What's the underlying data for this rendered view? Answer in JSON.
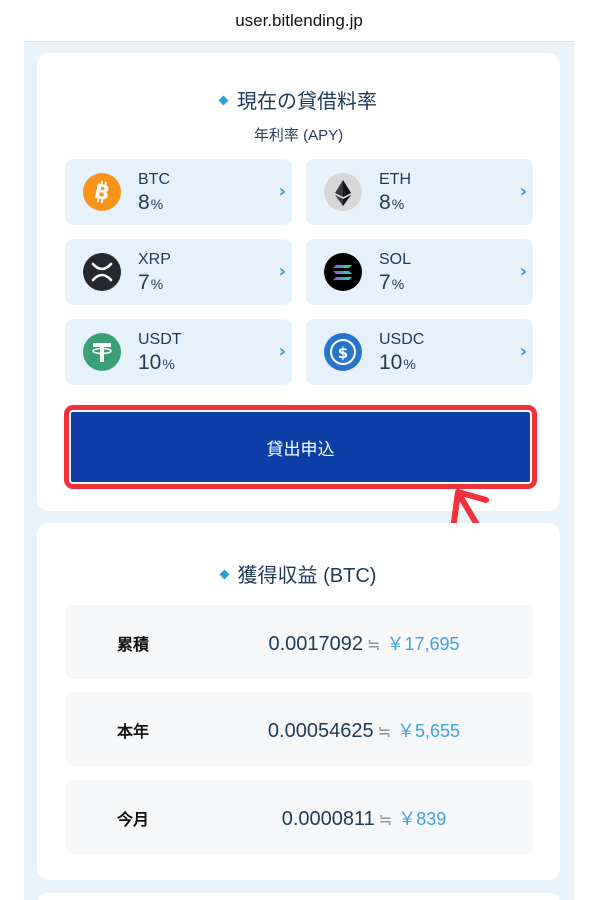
{
  "browser": {
    "url": "user.bitlending.jp"
  },
  "rates": {
    "title": "現在の貸借料率",
    "subtitle": "年利率 (APY)",
    "coins": [
      {
        "symbol": "BTC",
        "rate": "8",
        "unit": "%",
        "icon": "bitcoin-icon",
        "color": "#f7931a"
      },
      {
        "symbol": "ETH",
        "rate": "8",
        "unit": "%",
        "icon": "ethereum-icon",
        "color": "#d5d7da"
      },
      {
        "symbol": "XRP",
        "rate": "7",
        "unit": "%",
        "icon": "xrp-icon",
        "color": "#23292f"
      },
      {
        "symbol": "SOL",
        "rate": "7",
        "unit": "%",
        "icon": "solana-icon",
        "color": "#000000"
      },
      {
        "symbol": "USDT",
        "rate": "10",
        "unit": "%",
        "icon": "tether-icon",
        "color": "#3a9f75"
      },
      {
        "symbol": "USDC",
        "rate": "10",
        "unit": "%",
        "icon": "usdc-icon",
        "color": "#2775ca"
      }
    ],
    "lend_button": "貸出申込"
  },
  "earnings": {
    "title": "獲得収益 (BTC)",
    "approx_symbol": "≒",
    "rows": [
      {
        "label": "累積",
        "btc": "0.0017092",
        "yen": "￥17,695"
      },
      {
        "label": "本年",
        "btc": "0.00054625",
        "yen": "￥5,655"
      },
      {
        "label": "今月",
        "btc": "0.0000811",
        "yen": "￥839"
      }
    ]
  },
  "colors": {
    "accent": "#2a9fd8",
    "button": "#0d3fa8",
    "highlight": "#f0303a",
    "card_bg": "#e6f1fb",
    "page_bg": "#e8f2fb"
  }
}
